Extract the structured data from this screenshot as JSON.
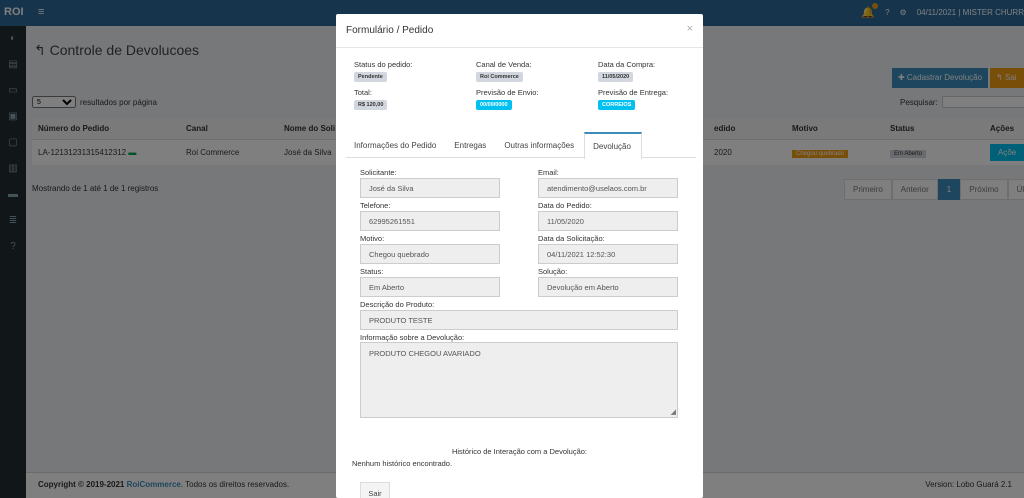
{
  "topbar": {
    "logo": "ROI",
    "date_user": "04/11/2021 | MISTER CHURR"
  },
  "page": {
    "title": "Controle de Devolucoes",
    "btn_add": "Cadastrar Devolução",
    "btn_orange": "Sai",
    "length_value": "5",
    "length_suffix": "resultados por página",
    "search_label": "Pesquisar:"
  },
  "table": {
    "headers": [
      "Número do Pedido",
      "Canal",
      "Nome do Soli",
      "edido",
      "Motivo",
      "Status",
      "Ações"
    ],
    "row": {
      "pedido": "LA-12131231315412312",
      "canal": "Roi Commerce",
      "nome": "José da Silva",
      "data": "2020",
      "motivo": "Chegou quebrado",
      "status": "Em Aberto",
      "acoes": "Açõe"
    }
  },
  "showing": "Mostrando de 1 até 1 de 1 registros",
  "pager": {
    "first": "Primeiro",
    "prev": "Anterior",
    "page": "1",
    "next": "Próximo",
    "last": "Últi"
  },
  "footer": {
    "copy": "Copyright © 2019-2021",
    "brand": "RoiCommerce",
    "rights": ". Todos os direitos reservados.",
    "version": "Version: Lobo Guará 2.1"
  },
  "modal": {
    "title": "Formulário / Pedido",
    "close": "×",
    "info": [
      {
        "label": "Status do pedido:",
        "value": "Pendente",
        "style": "gray"
      },
      {
        "label": "Canal de Venda:",
        "value": "Roi Commerce",
        "style": "gray"
      },
      {
        "label": "Data da Compra:",
        "value": "11/05/2020",
        "style": "gray"
      },
      {
        "label": "Total:",
        "value": "R$ 120,00",
        "style": "gray"
      },
      {
        "label": "Previsão de Envio:",
        "value": "00/00/0000",
        "style": "blue"
      },
      {
        "label": "Previsão de Entrega:",
        "value": "CORREIOS",
        "style": "blue"
      }
    ],
    "tabs": [
      "Informações do Pedido",
      "Entregas",
      "Outras informações",
      "Devolução"
    ],
    "fields": {
      "solicitante": {
        "label": "Solicitante:",
        "value": "José da Silva"
      },
      "email": {
        "label": "Email:",
        "value": "atendimento@uselaos.com.br"
      },
      "telefone": {
        "label": "Telefone:",
        "value": "62995261551"
      },
      "data_pedido": {
        "label": "Data do Pedido:",
        "value": "11/05/2020"
      },
      "motivo": {
        "label": "Motivo:",
        "value": "Chegou quebrado"
      },
      "data_solicitacao": {
        "label": "Data da Solicitação:",
        "value": "04/11/2021 12:52:30"
      },
      "status": {
        "label": "Status:",
        "value": "Em Aberto"
      },
      "solucao": {
        "label": "Solução:",
        "value": "Devolução em Aberto"
      },
      "descricao": {
        "label": "Descrição do Produto:",
        "value": "PRODUTO TESTE"
      },
      "informacao": {
        "label": "Informação sobre a Devolução:",
        "value": "PRODUTO CHEGOU AVARIADO"
      }
    },
    "history_title": "Histórico de Interação com a Devolução:",
    "history_empty": "Nenhum histórico encontrado.",
    "btn_sair": "Sair"
  }
}
